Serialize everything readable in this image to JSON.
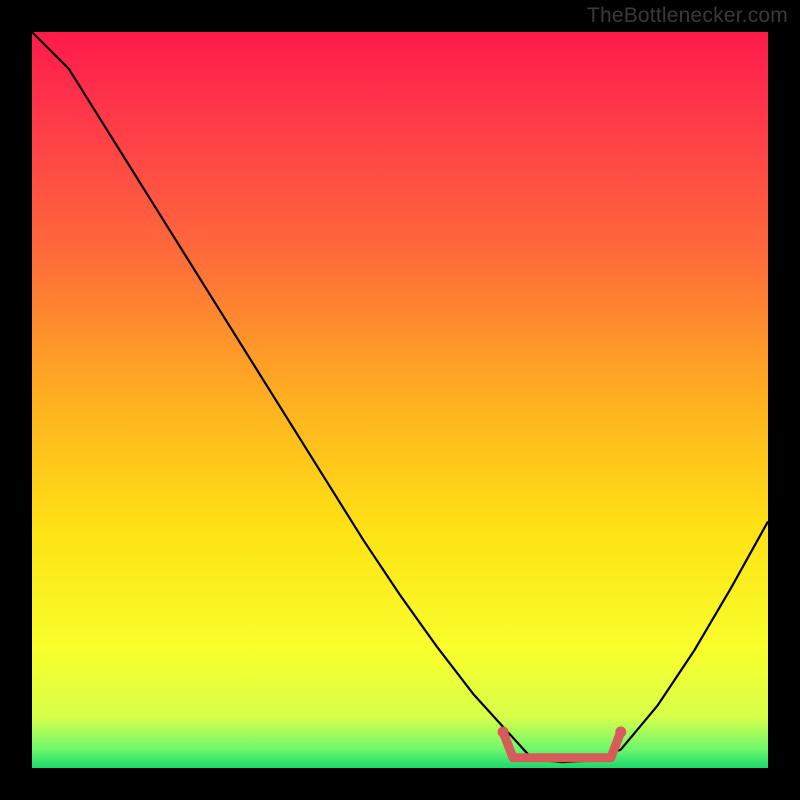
{
  "attribution": "TheBottlenecker.com",
  "chart_data": {
    "type": "line",
    "x": [
      0.0,
      0.05,
      0.1,
      0.15,
      0.2,
      0.25,
      0.3,
      0.35,
      0.4,
      0.45,
      0.5,
      0.55,
      0.6,
      0.65,
      0.68,
      0.72,
      0.76,
      0.8,
      0.85,
      0.9,
      0.95,
      1.0
    ],
    "values": [
      1.0,
      0.95,
      0.87,
      0.79,
      0.71,
      0.63,
      0.55,
      0.47,
      0.39,
      0.31,
      0.235,
      0.165,
      0.1,
      0.045,
      0.012,
      0.008,
      0.01,
      0.025,
      0.085,
      0.16,
      0.245,
      0.335
    ],
    "highlight_range": {
      "x_start": 0.64,
      "x_end": 0.8,
      "y_approx": 0.014
    },
    "title": "",
    "xlabel": "",
    "ylabel": "",
    "xlim": [
      0,
      1
    ],
    "ylim": [
      0,
      1
    ],
    "background_gradient": {
      "stops": [
        {
          "offset": 0.0,
          "color": "#ff1a4a"
        },
        {
          "offset": 0.12,
          "color": "#ff3a4a"
        },
        {
          "offset": 0.3,
          "color": "#ff6a3a"
        },
        {
          "offset": 0.5,
          "color": "#ffb020"
        },
        {
          "offset": 0.68,
          "color": "#ffe315"
        },
        {
          "offset": 0.84,
          "color": "#f8ff2c"
        },
        {
          "offset": 0.93,
          "color": "#d9ff4a"
        },
        {
          "offset": 0.975,
          "color": "#6cf76c"
        },
        {
          "offset": 1.0,
          "color": "#1bd96b"
        }
      ]
    },
    "curve_color": "#000000",
    "highlight_color": "#d85a5a"
  }
}
